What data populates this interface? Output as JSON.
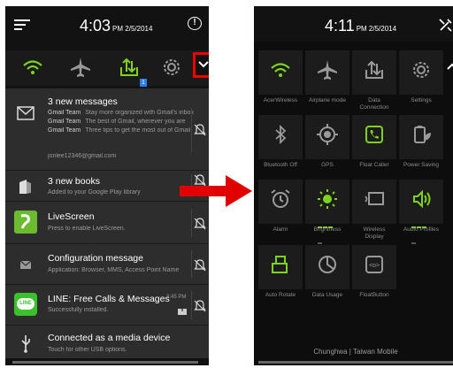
{
  "left": {
    "time": "4:03",
    "time_meta": "PM 2/5/2014",
    "qs_badge": "1",
    "notifications": {
      "gmail": {
        "title": "3 new messages",
        "lines": [
          {
            "from": "Gmail Team",
            "text": "Stay more organized with Gmail's inbox"
          },
          {
            "from": "Gmail Team",
            "text": "The best of Gmail, wherever you are"
          },
          {
            "from": "Gmail Team",
            "text": "Three tips to get the most out of Gmail"
          }
        ],
        "account": "jonlee12346@gmail.com"
      },
      "books": {
        "title": "3 new books",
        "sub": "Added to your Google Play library"
      },
      "livescreen": {
        "title": "LiveScreen",
        "sub": "Press to enable LiveScreen."
      },
      "config": {
        "title": "Configuration message",
        "sub": "Application: Browser, MMS, Access Point Name"
      },
      "line": {
        "title": "LINE: Free Calls & Messages",
        "sub": "Successfully installed.",
        "time": "3:45 PM",
        "icon_text": "LINE"
      },
      "usb": {
        "title": "Connected as a media device",
        "sub": "Touch for other USB options."
      }
    }
  },
  "right": {
    "time": "4:11",
    "time_meta": "PM 2/5/2014",
    "tiles": [
      {
        "label": "AcerWireless",
        "icon": "wifi-icon",
        "color": "#7ed321"
      },
      {
        "label": "Airplane mode",
        "icon": "airplane-icon",
        "color": "#9a9a9a"
      },
      {
        "label": "Data\nConnection",
        "icon": "data-connection-icon",
        "color": "#9a9a9a"
      },
      {
        "label": "Settings",
        "icon": "gear-icon",
        "color": "#9a9a9a"
      },
      {
        "label": "Bluetooth Off",
        "icon": "bluetooth-icon",
        "color": "#9a9a9a"
      },
      {
        "label": "GPS",
        "icon": "gps-icon",
        "color": "#9a9a9a"
      },
      {
        "label": "Float Caller",
        "icon": "float-caller-icon",
        "color": "#7ed321"
      },
      {
        "label": "Power Saving",
        "icon": "power-saving-icon",
        "color": "#9a9a9a"
      },
      {
        "label": "Alarm",
        "icon": "alarm-icon",
        "color": "#9a9a9a"
      },
      {
        "label": "Brightness",
        "icon": "brightness-icon",
        "color": "#7ed321"
      },
      {
        "label": "Wireless\nDisplay",
        "icon": "wireless-display-icon",
        "color": "#9a9a9a"
      },
      {
        "label": "Audio Profiles",
        "icon": "audio-profiles-icon",
        "color": "#7ed321"
      },
      {
        "label": "Auto Rotate",
        "icon": "auto-rotate-icon",
        "color": "#7ed321"
      },
      {
        "label": "Data Usage",
        "icon": "data-usage-icon",
        "color": "#9a9a9a"
      },
      {
        "label": "FloatButton",
        "icon": "float-button-icon",
        "color": "#9a9a9a"
      }
    ],
    "carrier": "Chunghwa  |  Taiwan Mobile"
  },
  "colors": {
    "accent_green": "#7ed321",
    "highlight_red": "#e00000",
    "arrow_red": "#e00000"
  }
}
